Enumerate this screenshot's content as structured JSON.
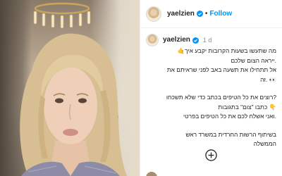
{
  "post": {
    "author": {
      "username": "yaelzien",
      "verified": true
    },
    "follow_label": "Follow",
    "separator": "•",
    "time": "1 d",
    "caption_lines": [
      "מה שתעשו בשעות הקרובות יקבע איך🤙",
      ".ייראה הצום שלכם",
      "אל תתחילו את תשעה באב לפני שראיתם את",
      "👀 .זה",
      "",
      "?רוצים את כל הטיפים בכתב כדי שלא תשכחו",
      "👇 כתבו \"צום\" בתגובות",
      ".ואני אשלח לכם את כל הטיפים בפרטי",
      "",
      "בשיתוף הרשות החרדית במשרד ראש",
      "הממשלה"
    ]
  },
  "colors": {
    "accent": "#0095f6",
    "text": "#262626",
    "muted": "#8e8e8e",
    "border": "#efefef",
    "verified": "#0095f6"
  },
  "icons": {
    "verified": "verified-badge-icon",
    "more": "more-options-icon",
    "add": "plus-circle-icon"
  }
}
